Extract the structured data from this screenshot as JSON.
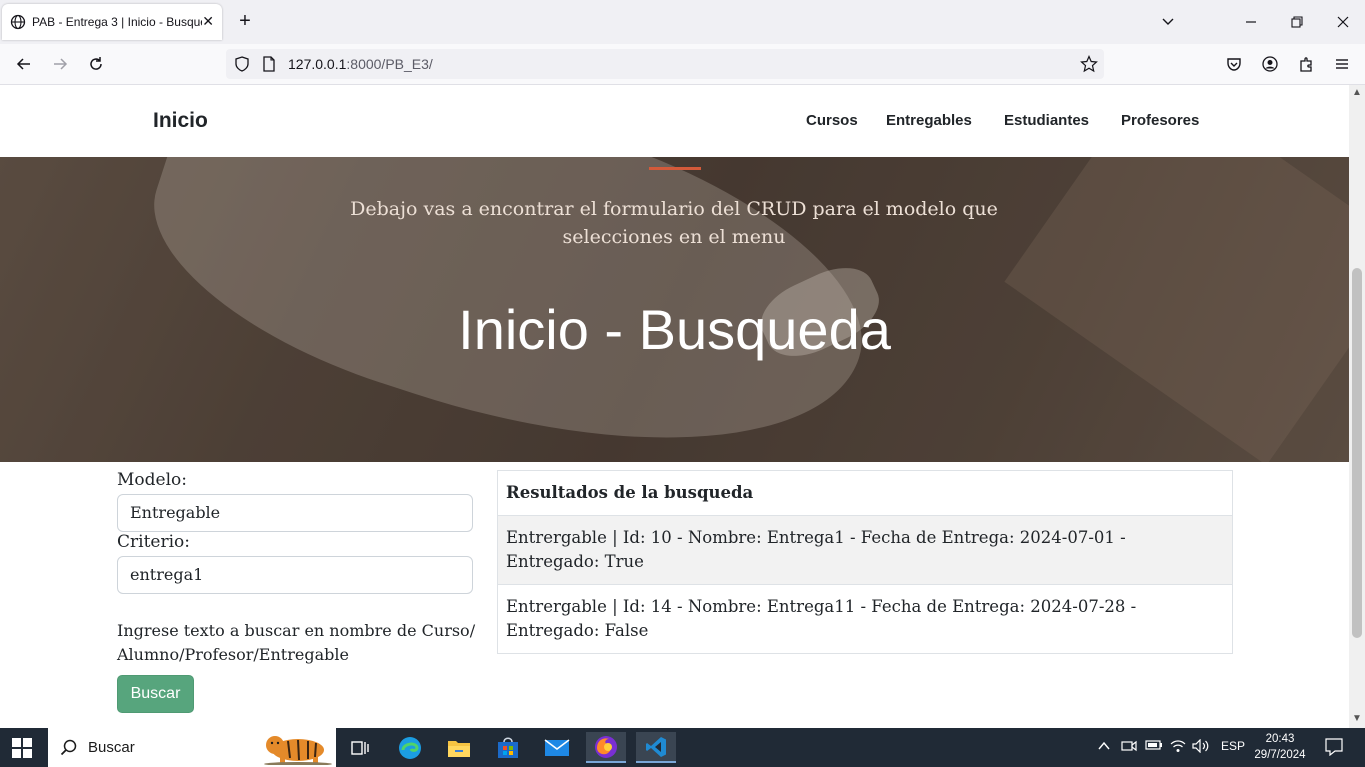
{
  "browser": {
    "tab_title": "PAB - Entrega 3 | Inicio - Busqueda",
    "url_host": "127.0.0.1",
    "url_rest": ":8000/PB_E3/"
  },
  "site": {
    "brand": "Inicio",
    "nav": [
      "Cursos",
      "Entregables",
      "Estudiantes",
      "Profesores"
    ]
  },
  "hero": {
    "subtitle": "Debajo vas a encontrar el formulario del CRUD para el modelo que selecciones en el menu",
    "title": "Inicio - Busqueda",
    "accent_color": "#d35a3a"
  },
  "form": {
    "modelo_label": "Modelo:",
    "modelo_value": "Entregable",
    "criterio_label": "Criterio:",
    "criterio_value": "entrega1",
    "help": "Ingrese texto a buscar en nombre de Curso/ Alumno/Profesor/Entregable",
    "button": "Buscar",
    "button_color": "#57a57d"
  },
  "results": {
    "header": "Resultados de la busqueda",
    "rows": [
      "Entrergable | Id: 10 - Nombre: Entrega1 - Fecha de Entrega: 2024-07-01 - Entregado: True",
      "Entrergable | Id: 14 - Nombre: Entrega11 - Fecha de Entrega: 2024-07-28 - Entregado: False"
    ]
  },
  "taskbar": {
    "search_placeholder": "Buscar",
    "language": "ESP",
    "time": "20:43",
    "date": "29/7/2024",
    "apps": [
      "task-view-icon",
      "edge-icon",
      "file-explorer-icon",
      "store-icon",
      "mail-icon",
      "firefox-icon",
      "vscode-icon"
    ]
  }
}
